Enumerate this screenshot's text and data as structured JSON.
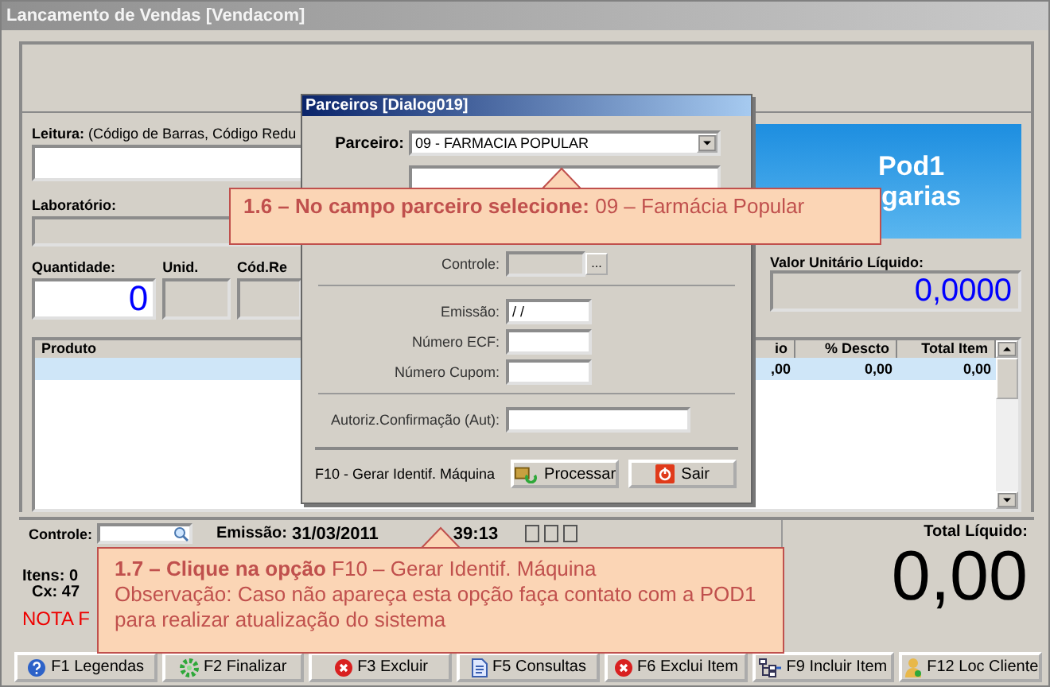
{
  "window": {
    "title": "Lancamento de Vendas [Vendacom]"
  },
  "sale_form": {
    "reading_label": "**Leitura:** (Código de Barras, Código Redu",
    "lab_label": "Laboratório:",
    "quantity": {
      "label": "Quantidade:",
      "value": "0"
    },
    "unit_label": "Unid.",
    "code_label": "Cód.Re",
    "logo": {
      "line_1": "Pod1",
      "line_2": "garias"
    },
    "unit_net_value": {
      "label": "Valor Unitário Líquido:",
      "value": "0,0000"
    }
  },
  "items_table": {
    "columns": [
      "Produto",
      "io",
      "% Descto",
      "Total Item"
    ],
    "rows": [
      {
        "cells": [
          "",
          ",00",
          "0,00",
          "0,00"
        ],
        "selected": true
      }
    ]
  },
  "footer": {
    "control_label": "Controle:",
    "issue_label": "Emissão:",
    "issue_date": "31/03/2011",
    "time": "39:13",
    "items": "Itens: 0",
    "cash": "Cx: 47",
    "note": "NOTA F",
    "total": {
      "label": "Total Líquido:",
      "value": "0,00"
    }
  },
  "buttons": [
    {
      "label": "F1 Legendas",
      "kind": "help"
    },
    {
      "label": "F2 Finalizar",
      "kind": "finish"
    },
    {
      "label": "F3 Excluir",
      "kind": "delete"
    },
    {
      "label": "F5 Consultas",
      "kind": "query"
    },
    {
      "label": "F6 Exclui Item",
      "kind": "delete"
    },
    {
      "label": "F9 Incluir Item",
      "kind": "add"
    },
    {
      "label": "F12 Loc Cliente",
      "kind": "client"
    }
  ],
  "dialog": {
    "title": "Parceiros [Dialog019]",
    "partner": {
      "label": "Parceiro:",
      "value": "09 - FARMACIA POPULAR"
    },
    "fields": [
      {
        "label": "Controle:",
        "kind": "lookup",
        "button": "...",
        "disabled": true
      },
      {
        "label": "Emissão:",
        "kind": "short",
        "value": "/ /",
        "disabled": false
      },
      {
        "label": "Número ECF:",
        "kind": "short",
        "disabled": false
      },
      {
        "label": "Número Cupom:",
        "kind": "short",
        "disabled": false
      },
      {
        "label": "Autoriz.Confirmação (Aut):",
        "kind": "wide",
        "disabled": false
      }
    ],
    "hint": "F10 - Gerar Identif. Máquina",
    "buttons": [
      {
        "label": "Processar",
        "kind": "process"
      },
      {
        "label": "Sair",
        "kind": "exit"
      }
    ]
  },
  "callouts": [
    {
      "lines": [
        "**1.6 – No campo parceiro selecione:** 09 – Farmácia Popular"
      ]
    },
    {
      "lines": [
        "**1.7 – Clique na opção** F10 – Gerar Identif. Máquina",
        "Observação: Caso não apareça esta opção faça contato com a POD1 para realizar atualização do sistema"
      ]
    }
  ]
}
